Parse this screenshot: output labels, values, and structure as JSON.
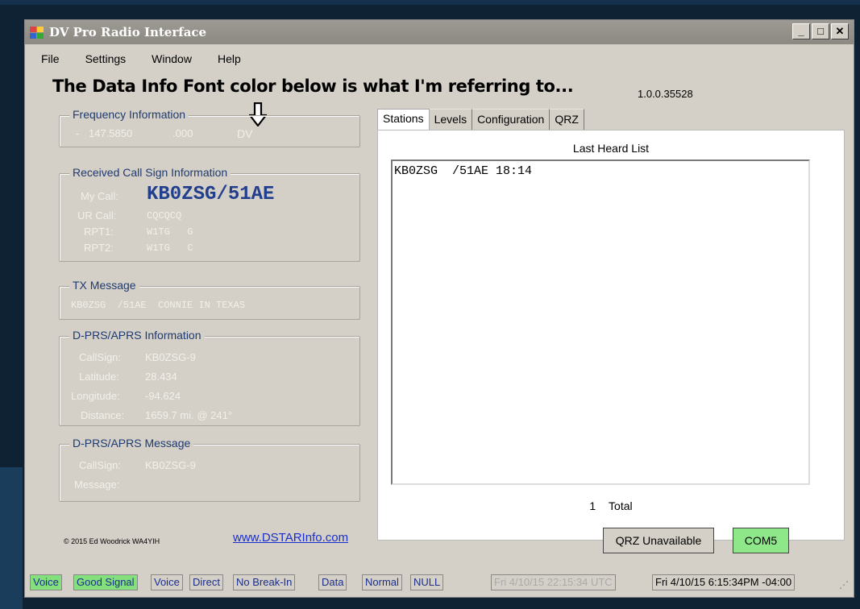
{
  "window": {
    "title": "DV Pro Radio Interface",
    "controls": [
      "_",
      "□",
      "✕"
    ]
  },
  "menu": [
    "File",
    "Settings",
    "Window",
    "Help"
  ],
  "annotation": "The Data Info Font color below is what I'm referring to...",
  "version": "1.0.0.35528",
  "frequency": {
    "legend": "Frequency Information",
    "prefix": "-",
    "freq": "147.5850",
    "offset": ".000",
    "mode": "DV"
  },
  "received_call": {
    "legend": "Received Call Sign Information",
    "my_call_label": "My Call:",
    "my_call": "KB0ZSG/51AE",
    "ur_call_label": "UR Call:",
    "ur_call": "CQCQCQ",
    "rpt1_label": "RPT1:",
    "rpt1": "W1TG   G",
    "rpt2_label": "RPT2:",
    "rpt2": "W1TG   C"
  },
  "tx_message": {
    "legend": "TX Message",
    "text": "KB0ZSG  /51AE  CONNIE IN TEXAS"
  },
  "dprs_info": {
    "legend": "D-PRS/APRS Information",
    "callsign_label": "CallSign:",
    "callsign": "KB0ZSG-9",
    "lat_label": "Latitude:",
    "lat": "28.434",
    "lon_label": "Longitude:",
    "lon": "-94.624",
    "dist_label": "Distance:",
    "dist": "1659.7 mi. @ 241°"
  },
  "dprs_msg": {
    "legend": "D-PRS/APRS Message",
    "callsign_label": "CallSign:",
    "callsign": "KB0ZSG-9",
    "message_label": "Message:",
    "message": ""
  },
  "footer": {
    "copyright": "© 2015 Ed Woodrick WA4YIH",
    "link": "www.DSTARInfo.com"
  },
  "tabs": [
    "Stations",
    "Levels",
    "Configuration",
    "QRZ"
  ],
  "stations": {
    "list_title": "Last Heard List",
    "entries": [
      "KB0ZSG  /51AE 18:14"
    ],
    "total_count": "1",
    "total_label": "Total"
  },
  "buttons": {
    "qrz": "QRZ Unavailable",
    "com": "COM5"
  },
  "status": {
    "voice1": "Voice",
    "signal": "Good Signal",
    "voice2": "Voice",
    "direct": "Direct",
    "breakin": "No Break-In",
    "data": "Data",
    "normal": "Normal",
    "null": "NULL",
    "utc_time": "Fri 4/10/15 22:15:34 UTC",
    "local_time": "Fri 4/10/15 6:15:34PM -04:00"
  },
  "colors": {
    "data_text": "#f2f0ea",
    "legend_text": "#1f3a70",
    "call_sign": "#223f8e",
    "status_green": "#84e07c",
    "com_green": "#8ee88a"
  }
}
